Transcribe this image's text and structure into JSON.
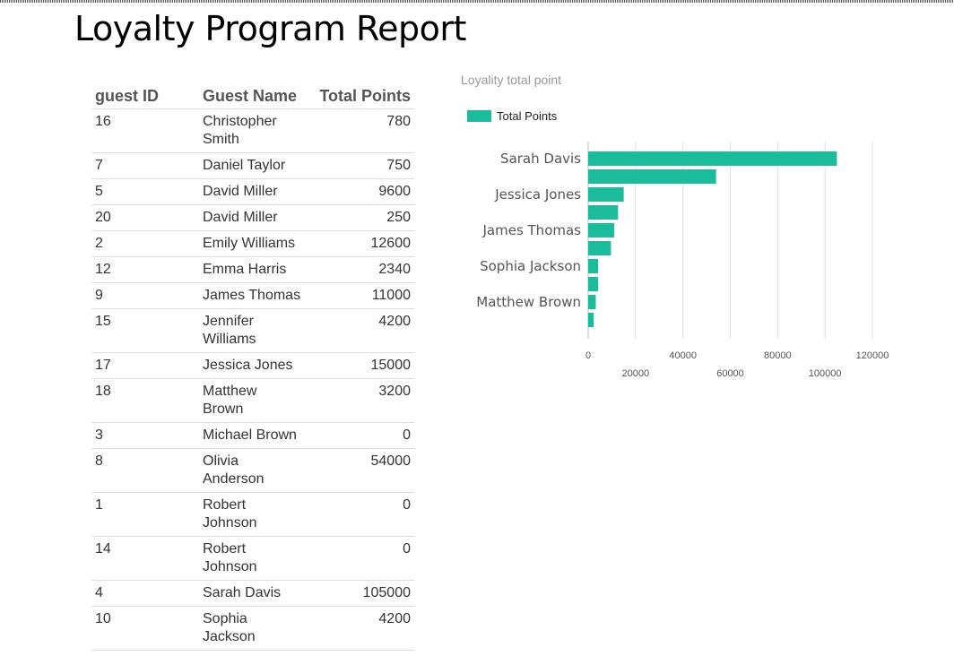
{
  "page": {
    "title": "Loyalty Program Report"
  },
  "table": {
    "headers": {
      "id": "guest ID",
      "name": "Guest Name",
      "points": "Total Points"
    },
    "rows": [
      {
        "id": "16",
        "name": "Christopher Smith",
        "points": "780"
      },
      {
        "id": "7",
        "name": "Daniel Taylor",
        "points": "750"
      },
      {
        "id": "5",
        "name": "David Miller",
        "points": "9600"
      },
      {
        "id": "20",
        "name": "David Miller",
        "points": "250"
      },
      {
        "id": "2",
        "name": "Emily Williams",
        "points": "12600"
      },
      {
        "id": "12",
        "name": "Emma Harris",
        "points": "2340"
      },
      {
        "id": "9",
        "name": "James Thomas",
        "points": "11000"
      },
      {
        "id": "15",
        "name": "Jennifer Williams",
        "points": "4200"
      },
      {
        "id": "17",
        "name": "Jessica Jones",
        "points": "15000"
      },
      {
        "id": "18",
        "name": "Matthew Brown",
        "points": "3200"
      },
      {
        "id": "3",
        "name": "Michael Brown",
        "points": "0"
      },
      {
        "id": "8",
        "name": "Olivia Anderson",
        "points": "54000"
      },
      {
        "id": "1",
        "name": "Robert Johnson",
        "points": "0"
      },
      {
        "id": "14",
        "name": "Robert Johnson",
        "points": "0"
      },
      {
        "id": "4",
        "name": "Sarah Davis",
        "points": "105000"
      },
      {
        "id": "10",
        "name": "Sophia Jackson",
        "points": "4200"
      }
    ]
  },
  "chart_data": {
    "type": "bar",
    "orientation": "horizontal",
    "title": "Loyality total point",
    "legend": {
      "position": "top-left"
    },
    "categories": [
      "Sarah Davis",
      "",
      "Jessica Jones",
      "",
      "James Thomas",
      "",
      "Sophia Jackson",
      "",
      "Matthew Brown",
      ""
    ],
    "series": [
      {
        "name": "Total Points",
        "color": "#1abc9c",
        "values": [
          105000,
          54000,
          15000,
          12600,
          11000,
          9600,
          4200,
          4200,
          3200,
          2340
        ]
      }
    ],
    "xlim": [
      0,
      120000
    ],
    "xticks": [
      0,
      20000,
      40000,
      60000,
      80000,
      100000,
      120000
    ],
    "grid": true
  }
}
